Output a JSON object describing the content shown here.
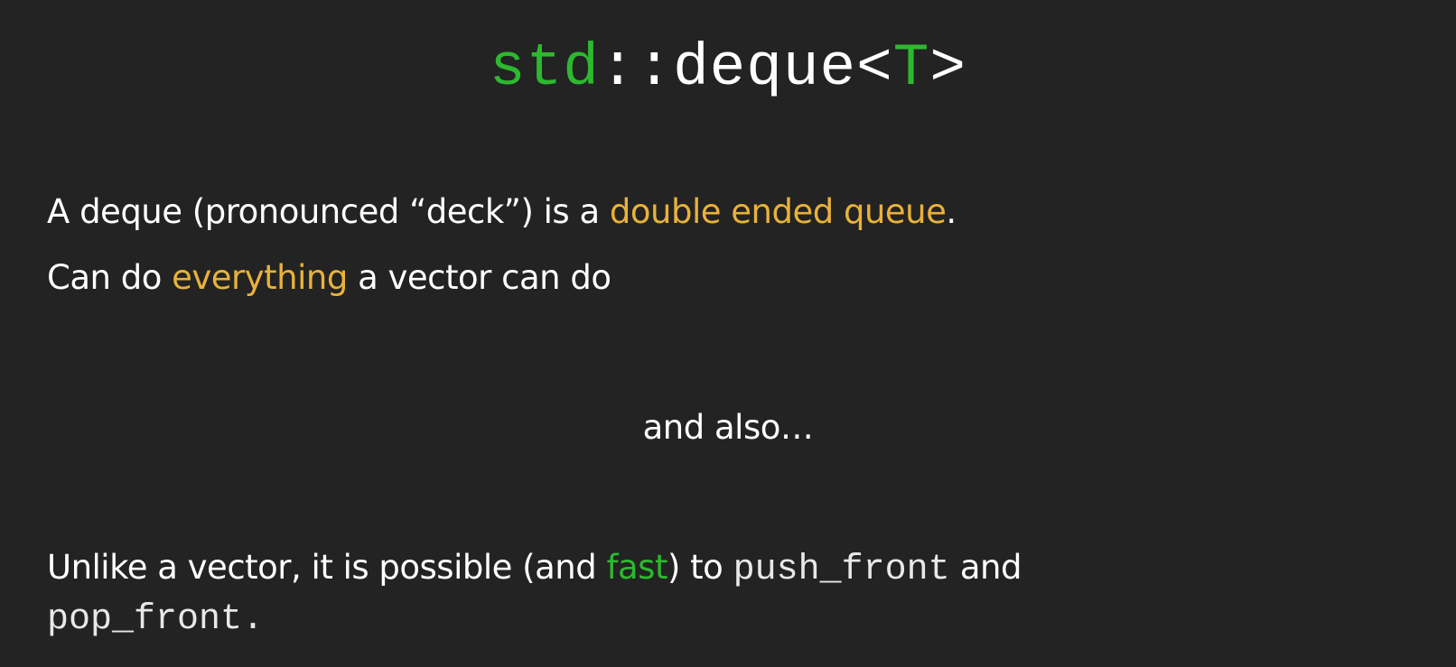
{
  "colors": {
    "background": "#232323",
    "text": "#ffffff",
    "green": "#2db92f",
    "orange": "#e8b23a"
  },
  "title": {
    "std": "std",
    "sep": "::",
    "deque": "deque",
    "lt": "<",
    "t": "T",
    "gt": ">"
  },
  "line1": {
    "before": "A deque (pronounced  “deck”) is a ",
    "highlight": "double ended queue",
    "after": "."
  },
  "line2": {
    "before": "Can do ",
    "highlight": "everything",
    "after": " a vector can do"
  },
  "line3": {
    "text": "and also…"
  },
  "line4": {
    "before": "Unlike a vector, it is possible (and ",
    "highlight": "fast",
    "middle": ") to ",
    "code": "push_front",
    "after": " and"
  },
  "line5": {
    "code": "pop_front",
    "after": "."
  }
}
